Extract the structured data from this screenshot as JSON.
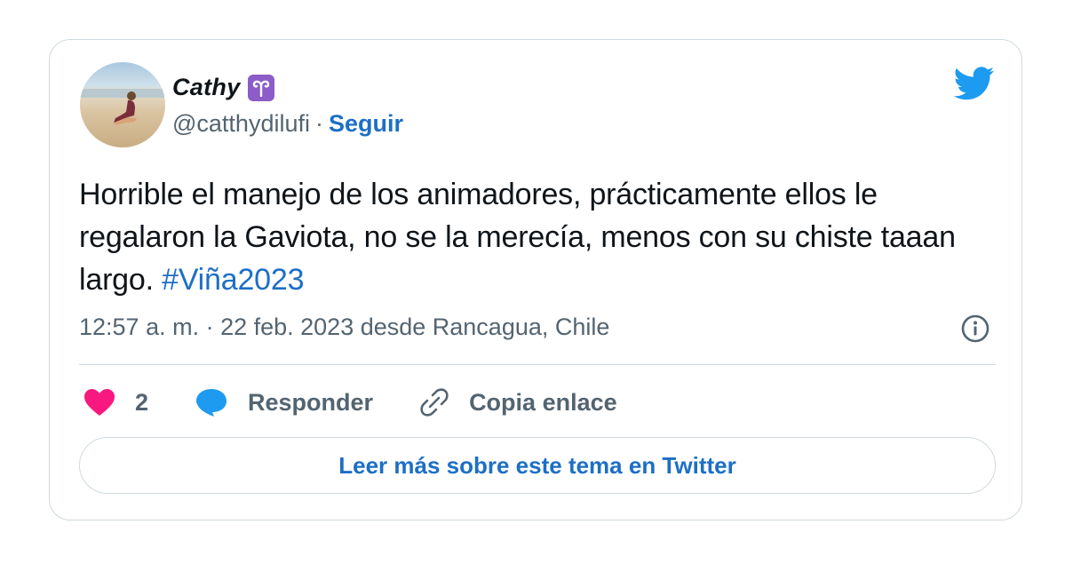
{
  "author": {
    "display_name": "Cathy",
    "badge": "♈",
    "handle": "@catthydilufi",
    "separator": "·",
    "follow_label": "Seguir"
  },
  "tweet": {
    "text": "Horrible el manejo de los animadores, prácticamente ellos le regalaron la Gaviota, no se la merecía, menos con su chiste taaan largo. ",
    "hashtag": "#Viña2023",
    "meta": "12:57 a. m. · 22 feb. 2023 desde Rancagua, Chile"
  },
  "actions": {
    "like_count": "2",
    "reply_label": "Responder",
    "copy_label": "Copia enlace"
  },
  "read_more_label": "Leer más sobre este tema en Twitter",
  "icons": {
    "bird": "twitter-bird-icon",
    "info": "info-icon",
    "heart": "heart-icon",
    "reply": "reply-bubble-icon",
    "link": "link-icon"
  },
  "colors": {
    "accent": "#1d6fc5",
    "bird": "#1d9bf0",
    "heart": "#f91880",
    "badge": "#8c5cc9",
    "muted": "#536471",
    "border": "#cfd9de"
  }
}
